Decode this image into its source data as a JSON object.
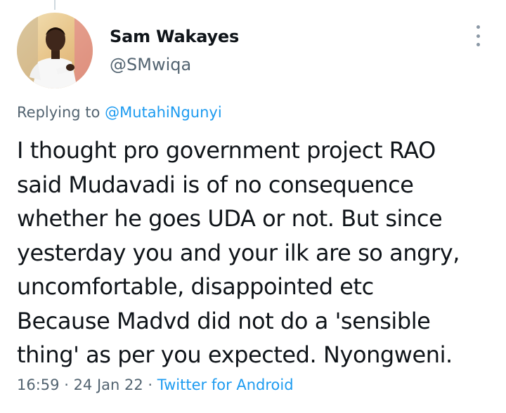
{
  "tweet": {
    "author_name": "Sam Wakayes",
    "author_handle": "@SMwiqa",
    "replying_prefix": "Replying to ",
    "replying_to": "@MutahiNgunyi",
    "text": "I thought pro government project RAO\nsaid Mudavadi is of no consequence\nwhether he goes UDA or not. But since\nyesterday you and your ilk are so angry,\nuncomfortable, disappointed etc\nBecause Madvd did not do a 'sensible\nthing' as per you expected. Nyongweni.",
    "time": "16:59",
    "separator": " · ",
    "date": "24 Jan 22",
    "source": "Twitter for Android"
  },
  "icons": {
    "more": "more-vertical-icon",
    "avatar": "profile-photo"
  },
  "colors": {
    "link": "#1d9bf0",
    "secondary_text": "#536471",
    "primary_text": "#0f1419",
    "thread_line": "#cfd9de"
  }
}
